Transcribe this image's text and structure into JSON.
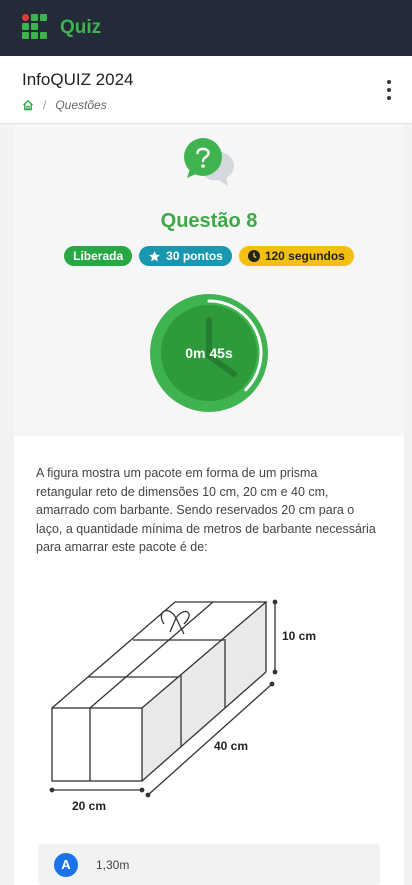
{
  "app": {
    "brand": "Quiz"
  },
  "header": {
    "title": "InfoQUIZ 2024",
    "breadcrumb": [
      "Questões"
    ]
  },
  "question": {
    "title": "Questão 8",
    "badges": {
      "status": "Liberada",
      "points": "30 pontos",
      "time": "120 segundos"
    },
    "timer": {
      "label": "0m 45s",
      "remaining_fraction": 0.375
    },
    "text": "A figura mostra um pacote em forma de um prisma retangular reto de dimensões 10 cm, 20 cm e 40 cm, amarrado com barbante. Sendo reservados 20 cm para o laço, a quantidade mínima de metros de barbante necessária para amarrar este pacote é de:",
    "figure": {
      "height_label": "10 cm",
      "length_label": "40 cm",
      "width_label": "20 cm"
    },
    "options": [
      {
        "letter": "A",
        "text": "1,30m"
      }
    ]
  },
  "colors": {
    "topbar": "#232a38",
    "brand": "#3fb34f",
    "accent_green": "#28a745",
    "teal": "#1a97b0",
    "yellow": "#f4c010",
    "option_blue": "#1a73e8"
  }
}
